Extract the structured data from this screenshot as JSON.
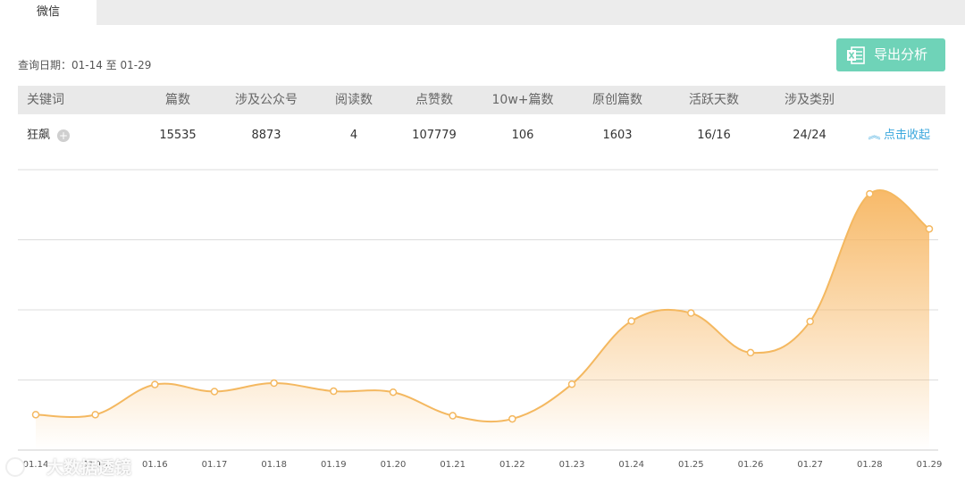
{
  "tab": {
    "label": "微信"
  },
  "date_range": "查询日期：01-14 至 01-29",
  "export_button": {
    "label": "导出分析"
  },
  "table": {
    "headers": [
      "关键词",
      "篇数",
      "涉及公众号",
      "阅读数",
      "点赞数",
      "10w+篇数",
      "原创篇数",
      "活跃天数",
      "涉及类别"
    ],
    "row": {
      "keyword": "狂飙",
      "values": [
        "15535",
        "8873",
        "4",
        "107779",
        "106",
        "1603",
        "16/16",
        "24/24"
      ]
    },
    "collapse_label": "点击收起"
  },
  "watermark": {
    "text": "大数据透镜"
  },
  "colors": {
    "line": "#f4b860",
    "accent": "#6fd3b8",
    "link": "#3aa7dd"
  },
  "chart_data": {
    "type": "area",
    "x": [
      "01.14",
      "01.15",
      "01.16",
      "01.17",
      "01.18",
      "01.19",
      "01.20",
      "01.21",
      "01.22",
      "01.23",
      "01.24",
      "01.25",
      "01.26",
      "01.27",
      "01.28",
      "01.29"
    ],
    "values": [
      505,
      505,
      935,
      835,
      955,
      840,
      825,
      490,
      445,
      940,
      1840,
      1955,
      1390,
      1835,
      3655,
      3155
    ],
    "ylim": [
      0,
      4000
    ],
    "grid": true,
    "y_axis_labels": false
  }
}
